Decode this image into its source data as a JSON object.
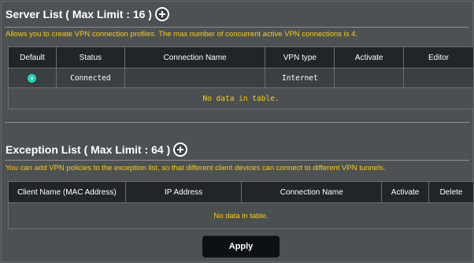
{
  "server_list": {
    "title": "Server List ( Max Limit : 16 )",
    "description": "Allows you to create VPN connection profiles. The max number of concurrent active VPN connections is 4.",
    "columns": [
      "Default",
      "Status",
      "Connection Name",
      "VPN type",
      "Activate",
      "Editor"
    ],
    "rows": [
      {
        "default_selected": true,
        "status": "Connected",
        "connection_name": "",
        "vpn_type": "Internet",
        "activate": "",
        "editor": ""
      }
    ],
    "empty_message": "No data in table."
  },
  "exception_list": {
    "title": "Exception List ( Max Limit : 64 )",
    "description": "You can add VPN policies to the exception list, so that different client devices can connect to different VPN tunnels.",
    "columns": [
      "Client Name (MAC Address)",
      "IP Address",
      "Connection Name",
      "Activate",
      "Delete"
    ],
    "empty_message": "No data in table."
  },
  "apply_label": "Apply",
  "colors": {
    "accent_text": "#ffcc00",
    "radio": "#1ad6b6",
    "background": "#4d5154"
  },
  "icons": {
    "add": "plus-circle-icon",
    "radio": "radio-selected-icon"
  }
}
